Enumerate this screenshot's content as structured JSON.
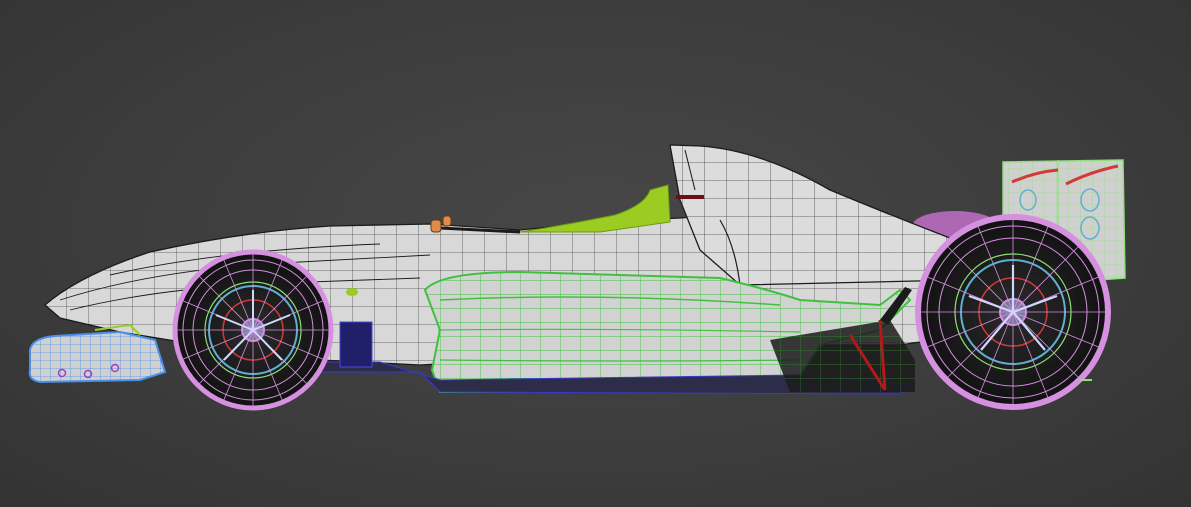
{
  "viewport": {
    "background": "#3c3c3c",
    "model": "formula-race-car-wireframe-side-view"
  },
  "colors": {
    "body_shell": "#d8d8d8",
    "wire_black": "#1b1b1b",
    "sidepod_wire": "#3ec23e",
    "wheel_wire": "#d590e0",
    "front_wing_wire": "#4a8fe8",
    "rear_wing_wire": "#8fe07a",
    "cockpit_accent": "#9ccc22",
    "rear_wing_decal": "#d23a3a",
    "suspension": "#b01a1a"
  }
}
